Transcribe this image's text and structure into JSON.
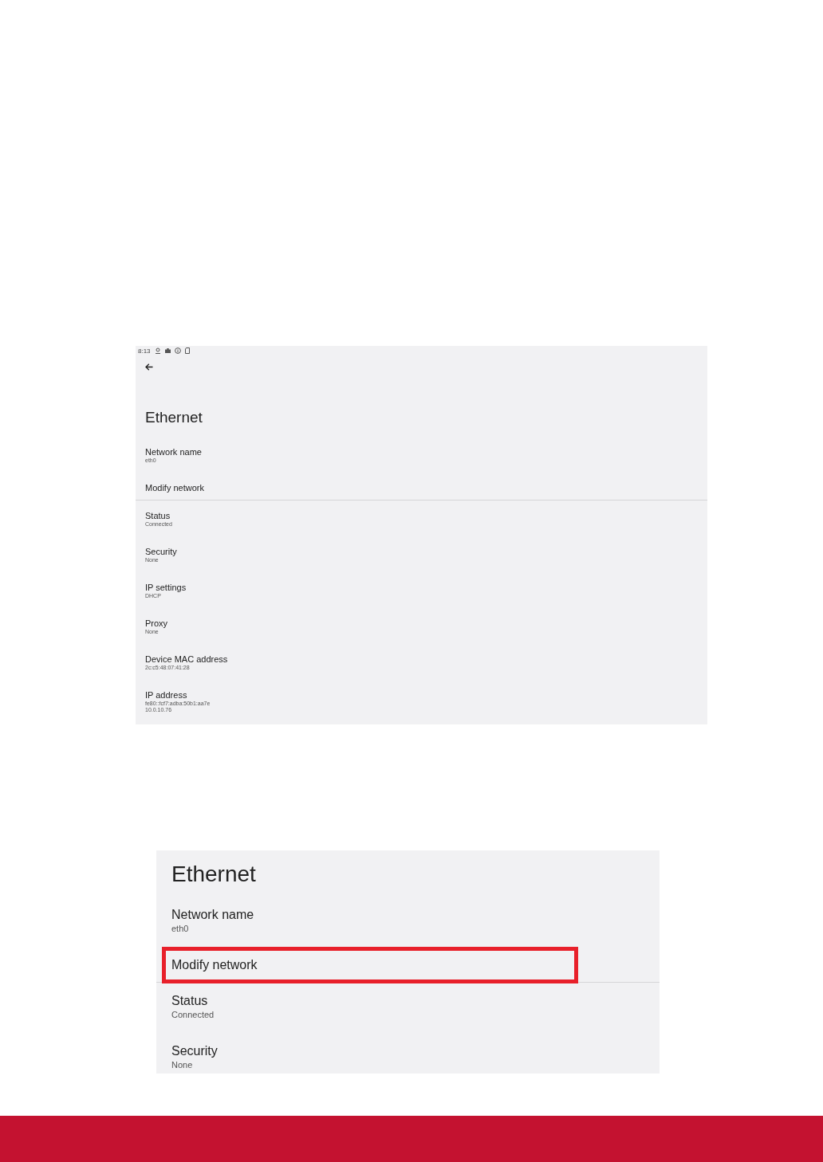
{
  "screenshots": [
    {
      "status_bar": {
        "time": "8:13"
      },
      "title": "Ethernet",
      "items": [
        {
          "kind": "setting",
          "label": "Network name",
          "values": [
            "eth0"
          ],
          "highlighted": false
        },
        {
          "kind": "action",
          "label": "Modify network",
          "highlighted": false
        },
        {
          "kind": "setting",
          "label": "Status",
          "values": [
            "Connected"
          ],
          "highlighted": false
        },
        {
          "kind": "setting",
          "label": "Security",
          "values": [
            "None"
          ],
          "highlighted": false
        },
        {
          "kind": "setting",
          "label": "IP settings",
          "values": [
            "DHCP"
          ],
          "highlighted": false
        },
        {
          "kind": "setting",
          "label": "Proxy",
          "values": [
            "None"
          ],
          "highlighted": false
        },
        {
          "kind": "setting",
          "label": "Device MAC address",
          "values": [
            "2c:c5:48:07:41:28"
          ],
          "highlighted": false
        },
        {
          "kind": "setting",
          "label": "IP address",
          "values": [
            "fe80::fcf7:adba:50b1:aa7e",
            "10.0.10.76"
          ],
          "highlighted": false
        }
      ]
    },
    {
      "title": "Ethernet",
      "items": [
        {
          "kind": "setting",
          "label": "Network name",
          "values": [
            "eth0"
          ],
          "highlighted": false
        },
        {
          "kind": "action",
          "label": "Modify network",
          "highlighted": true
        },
        {
          "kind": "setting",
          "label": "Status",
          "values": [
            "Connected"
          ],
          "highlighted": false
        },
        {
          "kind": "setting",
          "label": "Security",
          "values": [
            "None"
          ],
          "highlighted": false
        }
      ]
    }
  ]
}
